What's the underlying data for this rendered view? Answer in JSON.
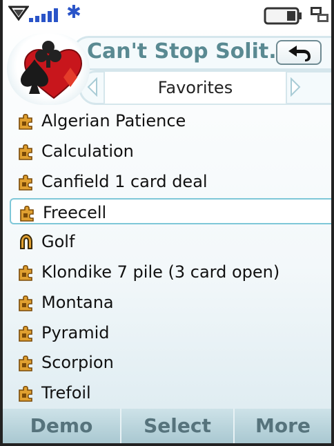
{
  "status_bar": {
    "icons": [
      "network-triangles-icon",
      "signal-bars-icon",
      "bluetooth-icon",
      "battery-icon",
      "data-transfer-icon"
    ],
    "bluetooth_glyph": "✱"
  },
  "header": {
    "app_icon": "card-suits-icon",
    "title": "Can't Stop Solit...",
    "back_icon": "back-arrow-icon",
    "tab": {
      "label": "Favorites",
      "left_icon": "chevron-left-icon",
      "right_icon": "chevron-right-icon"
    }
  },
  "games": [
    {
      "label": "Algerian Patience",
      "icon": "puzzle-icon",
      "selected": false
    },
    {
      "label": "Calculation",
      "icon": "puzzle-icon",
      "selected": false
    },
    {
      "label": "Canfield 1 card deal",
      "icon": "puzzle-icon",
      "selected": false
    },
    {
      "label": "Freecell",
      "icon": "puzzle-icon",
      "selected": true
    },
    {
      "label": "Golf",
      "icon": "horseshoe-icon",
      "selected": false
    },
    {
      "label": "Klondike 7 pile (3 card open)",
      "icon": "puzzle-icon",
      "selected": false
    },
    {
      "label": "Montana",
      "icon": "puzzle-icon",
      "selected": false
    },
    {
      "label": "Pyramid",
      "icon": "puzzle-icon",
      "selected": false
    },
    {
      "label": "Scorpion",
      "icon": "puzzle-icon",
      "selected": false
    },
    {
      "label": "Trefoil",
      "icon": "puzzle-icon",
      "selected": false
    }
  ],
  "softkeys": {
    "left": "Demo",
    "center": "Select",
    "right": "More"
  },
  "colors": {
    "title": "#5a8a92",
    "softkey_text": "#56737c",
    "selection_border": "#7ec7d8",
    "bluetooth": "#2a54c8",
    "puzzle": "#e0a030"
  }
}
